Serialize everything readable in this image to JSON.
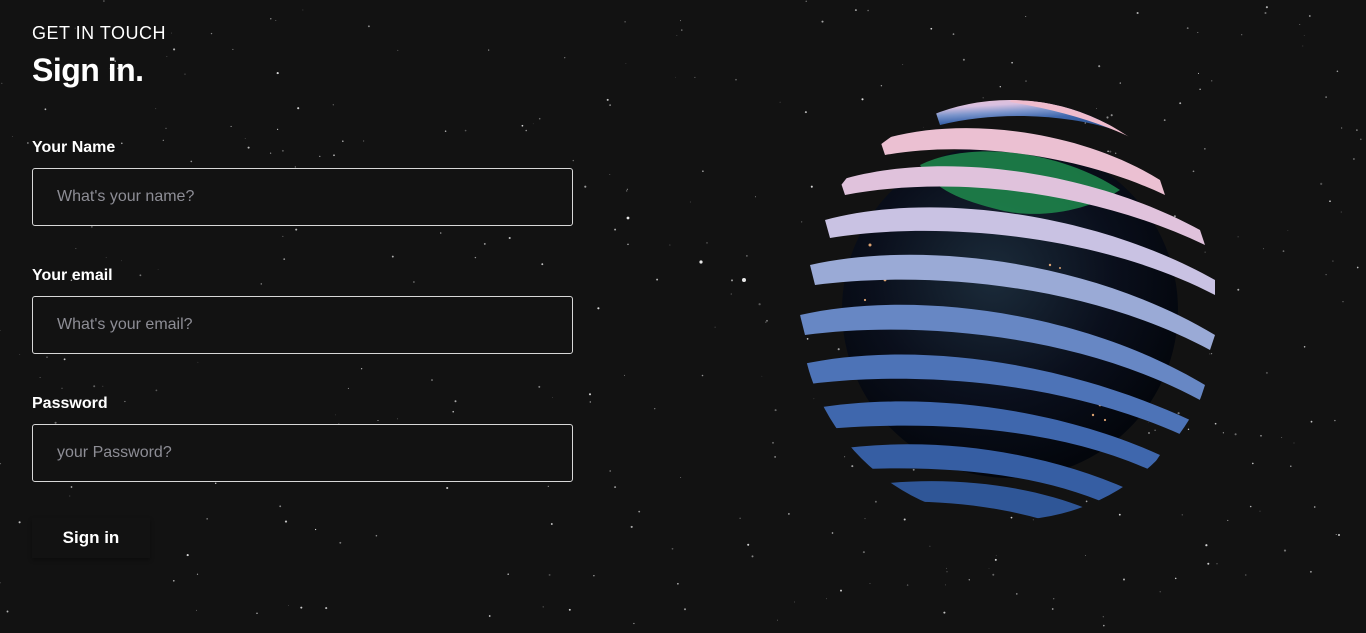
{
  "header": {
    "eyebrow": "GET IN TOUCH",
    "title": "Sign in."
  },
  "form": {
    "name": {
      "label": "Your Name",
      "placeholder": "What's your name?",
      "value": ""
    },
    "email": {
      "label": "Your email",
      "placeholder": "What's your email?",
      "value": ""
    },
    "password": {
      "label": "Password",
      "placeholder": "your Password?",
      "value": ""
    },
    "submit_label": "Sign in"
  },
  "scene": {
    "globe_icon": "earth-globe-icon",
    "ribbon_color_top": "#e6b4c8",
    "ribbon_color_bottom": "#3c64aa"
  },
  "colors": {
    "background": "#121212",
    "text": "#ffffff",
    "placeholder": "#8d8d95",
    "input_border": "#d8d8d8"
  }
}
